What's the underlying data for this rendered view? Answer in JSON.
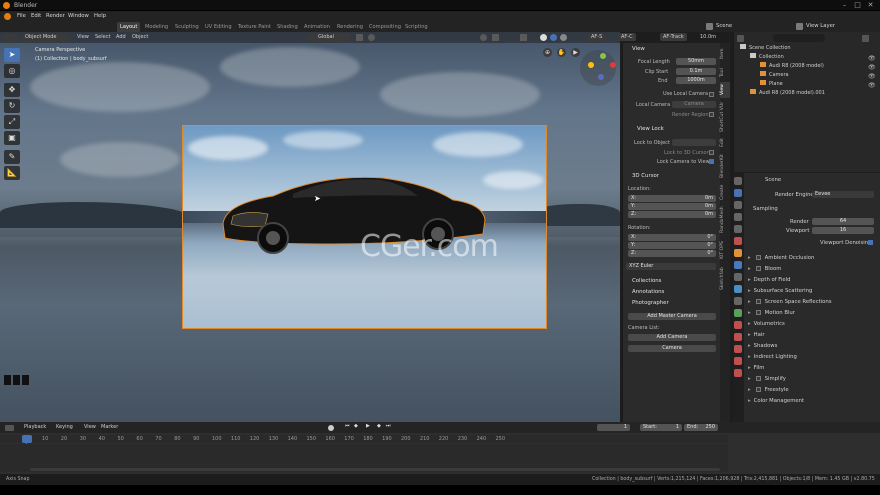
{
  "app": {
    "title": "Blender"
  },
  "menus": [
    "File",
    "Edit",
    "Render",
    "Window",
    "Help"
  ],
  "workspaces": [
    "Layout",
    "Modeling",
    "Sculpting",
    "UV Editing",
    "Texture Paint",
    "Shading",
    "Animation",
    "Rendering",
    "Compositing",
    "Scripting"
  ],
  "scene": {
    "scene_name": "Scene",
    "view_layer": "View Layer"
  },
  "viewport": {
    "mode": "Object Mode",
    "menus": [
      "View",
      "Select",
      "Add",
      "Object"
    ],
    "transform_orientation": "Global",
    "perspective_title": "Camera Perspective",
    "collection_info": "(1) Collection | body_subsurf",
    "watermark": "CGer.com",
    "af_buttons": [
      "AF-S",
      "AF-C",
      "AF-Track"
    ],
    "focal_readout": "10.0m"
  },
  "n_panel": {
    "view": {
      "header": "View",
      "focal_length_label": "Focal Length",
      "focal_length_value": "50mm",
      "clip_start_label": "Clip Start",
      "clip_start_value": "0.1m",
      "clip_end_label": "End",
      "clip_end_value": "1000m",
      "use_local_camera": "Use Local Camera",
      "local_camera_label": "Local Camera",
      "local_camera_value": "Camera",
      "render_region": "Render Region"
    },
    "view_lock": {
      "header": "View Lock",
      "lock_to_object": "Lock to Object",
      "lock_to_3d_cursor": "Lock to 3D Cursor",
      "lock_camera_to_view": "Lock Camera to View"
    },
    "cursor": {
      "header": "3D Cursor",
      "location_label": "Location:",
      "x_label": "X:",
      "x_value": "0m",
      "y_label": "Y:",
      "y_value": "0m",
      "z_label": "Z:",
      "z_value": "0m",
      "rotation_label": "Rotation:",
      "rx_label": "X:",
      "rx_value": "0°",
      "ry_label": "Y:",
      "ry_value": "0°",
      "rz_label": "Z:",
      "rz_value": "0°",
      "rotation_mode": "XYZ Euler"
    },
    "collections": "Collections",
    "annotations": "Annotations",
    "photographer": {
      "header": "Photographer",
      "add_master_camera": "Add Master Camera",
      "camera_list_label": "Camera List:",
      "add_camera": "Add Camera",
      "camera_item": "Camera"
    }
  },
  "side_tabs": [
    "Item",
    "Tool",
    "View",
    "ShortCut VUr",
    "Edit",
    "BlenderKit",
    "Create",
    "RandoMesh",
    "KIT OPS",
    "Sketchfab"
  ],
  "outliner": {
    "search_placeholder": "",
    "rows": [
      {
        "label": "Scene Collection",
        "indent": 0
      },
      {
        "label": "Collection",
        "indent": 1
      },
      {
        "label": "Audi R8 (2008 model)",
        "indent": 2
      },
      {
        "label": "Camera",
        "indent": 2
      },
      {
        "label": "Plane",
        "indent": 2
      },
      {
        "label": "Audi R8 (2008 model).001",
        "indent": 1
      }
    ]
  },
  "properties": {
    "scene_name": "Scene",
    "render_engine_label": "Render Engine",
    "render_engine_value": "Eevee",
    "sampling": "Sampling",
    "render_label": "Render",
    "render_value": "64",
    "viewport_label": "Viewport",
    "viewport_value": "16",
    "viewport_denoising": "Viewport Denoising",
    "sections": [
      {
        "label": "Ambient Occlusion",
        "checkbox": true
      },
      {
        "label": "Bloom",
        "checkbox": true
      },
      {
        "label": "Depth of Field",
        "checkbox": false
      },
      {
        "label": "Subsurface Scattering",
        "checkbox": false
      },
      {
        "label": "Screen Space Reflections",
        "checkbox": true
      },
      {
        "label": "Motion Blur",
        "checkbox": true
      },
      {
        "label": "Volumetrics",
        "checkbox": false
      },
      {
        "label": "Hair",
        "checkbox": false
      },
      {
        "label": "Shadows",
        "checkbox": false
      },
      {
        "label": "Indirect Lighting",
        "checkbox": false
      },
      {
        "label": "Film",
        "checkbox": false
      },
      {
        "label": "Simplify",
        "checkbox": true
      },
      {
        "label": "Freestyle",
        "checkbox": true
      },
      {
        "label": "Color Management",
        "checkbox": false
      }
    ]
  },
  "timeline": {
    "menus": [
      "Playback",
      "Keying",
      "View",
      "Marker"
    ],
    "current_frame": "1",
    "start_label": "Start:",
    "start_value": "1",
    "end_label": "End:",
    "end_value": "250",
    "ticks": [
      "1",
      "10",
      "20",
      "30",
      "40",
      "50",
      "60",
      "70",
      "80",
      "90",
      "100",
      "110",
      "120",
      "130",
      "140",
      "150",
      "160",
      "170",
      "180",
      "190",
      "200",
      "210",
      "220",
      "230",
      "240",
      "250"
    ]
  },
  "status": {
    "left": "Axis Snap",
    "right": "Collection | body_subsurf | Verts:1,215,124 | Faces:1,206,928 | Tris:2,415,881 | Objects:1/8 | Mem: 1.45 GB | v2.80.75"
  },
  "colors": {
    "accent": "#4772b3",
    "selection": "#e08a2a"
  }
}
